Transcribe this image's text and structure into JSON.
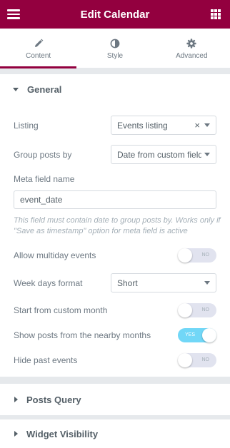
{
  "header": {
    "title": "Edit Calendar"
  },
  "tabs": [
    {
      "label": "Content"
    },
    {
      "label": "Style"
    },
    {
      "label": "Advanced"
    }
  ],
  "general": {
    "title": "General",
    "listing": {
      "label": "Listing",
      "value": "Events listing",
      "clear": "×"
    },
    "group_by": {
      "label": "Group posts by",
      "value": "Date from custom field"
    },
    "meta_field": {
      "label": "Meta field name",
      "value": "event_date"
    },
    "meta_note": "This field must contain date to group posts by. Works only if \"Save as timestamp\" option for meta field is active",
    "multiday": {
      "label": "Allow multiday events",
      "state": "NO"
    },
    "week_days": {
      "label": "Week days format",
      "value": "Short"
    },
    "custom_month": {
      "label": "Start from custom month",
      "state": "NO"
    },
    "nearby": {
      "label": "Show posts from the nearby months",
      "state": "YES"
    },
    "hide_past": {
      "label": "Hide past events",
      "state": "NO"
    }
  },
  "sections": {
    "posts_query": "Posts Query",
    "widget_visibility": "Widget Visibility"
  },
  "colors": {
    "brand": "#93003f",
    "switch_on": "#71d7f7",
    "switch_off": "#e1e3ef"
  }
}
